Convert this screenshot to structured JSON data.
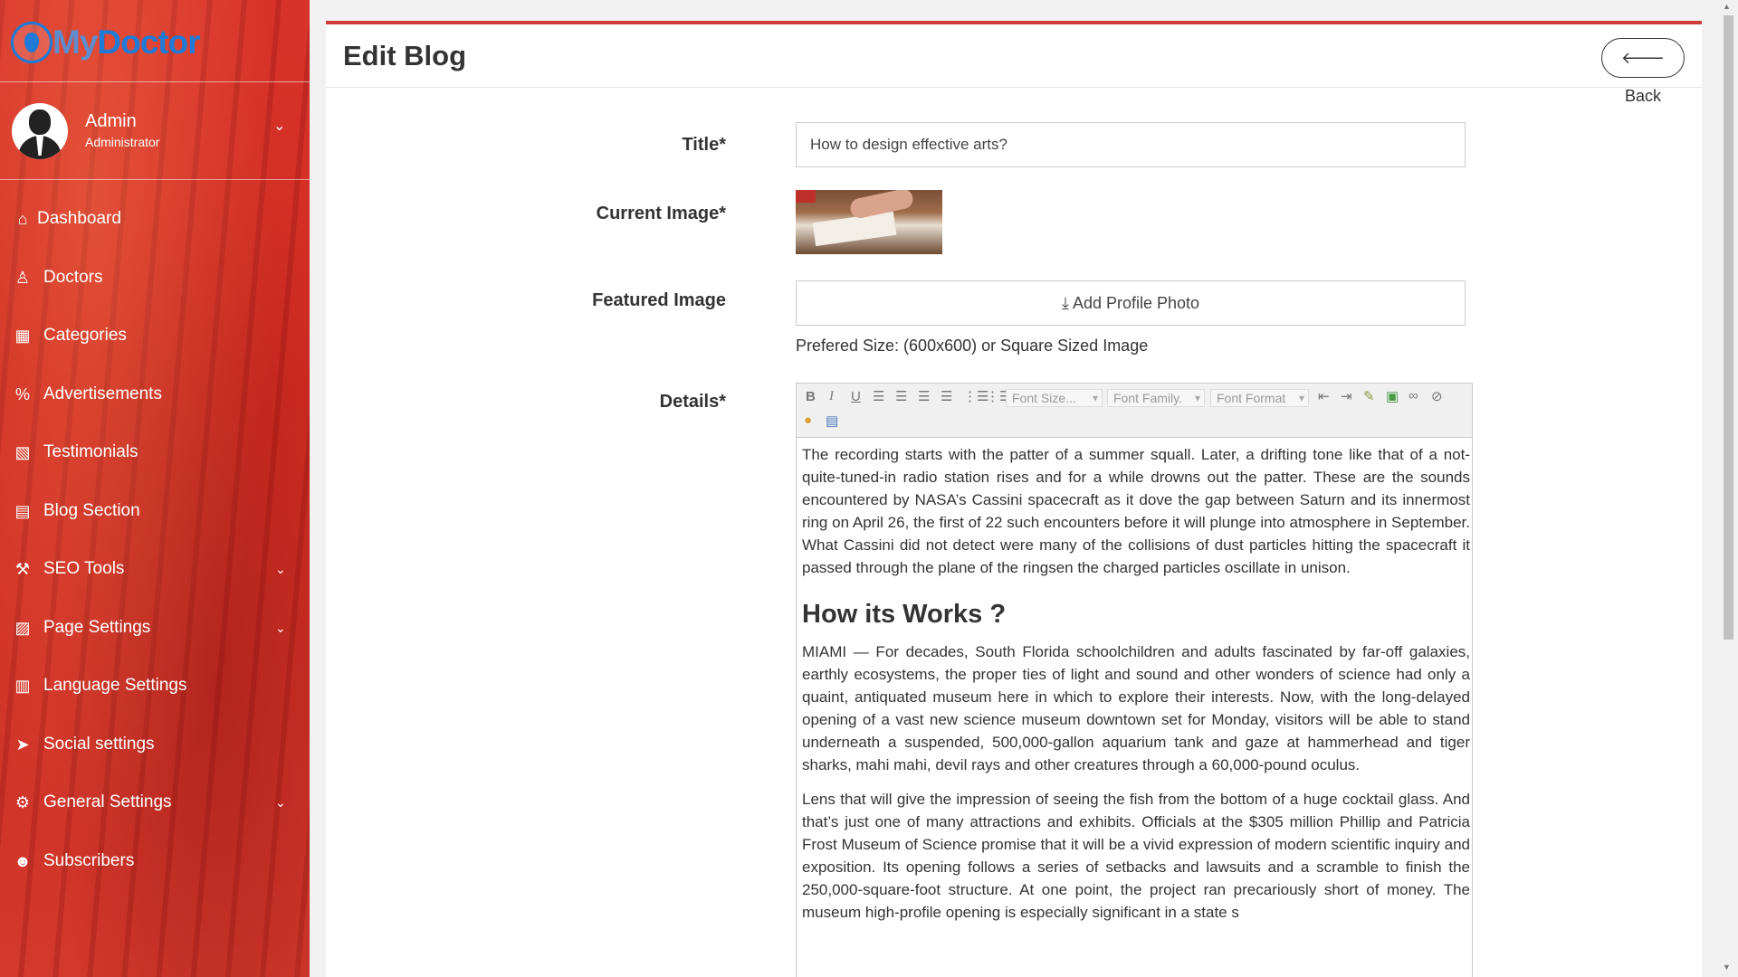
{
  "app": {
    "logo_part1": "My",
    "logo_part2": "Doctor"
  },
  "profile": {
    "name": "Admin",
    "role": "Administrator"
  },
  "sidebar": {
    "items": [
      {
        "label": "Dashboard",
        "icon": "home-icon",
        "glyph": "⌂",
        "has_submenu": false
      },
      {
        "label": "Doctors",
        "icon": "user-doctor-icon",
        "glyph": "♙",
        "has_submenu": false
      },
      {
        "label": "Categories",
        "icon": "calendar-icon",
        "glyph": "▦",
        "has_submenu": false
      },
      {
        "label": "Advertisements",
        "icon": "percent-icon",
        "glyph": "%",
        "has_submenu": false
      },
      {
        "label": "Testimonials",
        "icon": "image-file-icon",
        "glyph": "▧",
        "has_submenu": false
      },
      {
        "label": "Blog Section",
        "icon": "file-text-icon",
        "glyph": "▤",
        "has_submenu": false
      },
      {
        "label": "SEO Tools",
        "icon": "wrench-icon",
        "glyph": "⚒",
        "has_submenu": true
      },
      {
        "label": "Page Settings",
        "icon": "code-file-icon",
        "glyph": "▨",
        "has_submenu": true
      },
      {
        "label": "Language Settings",
        "icon": "language-icon",
        "glyph": "▥",
        "has_submenu": false
      },
      {
        "label": "Social settings",
        "icon": "paper-plane-icon",
        "glyph": "➤",
        "has_submenu": false
      },
      {
        "label": "General Settings",
        "icon": "cogs-icon",
        "glyph": "⚙",
        "has_submenu": true
      },
      {
        "label": "Subscribers",
        "icon": "users-icon",
        "glyph": "☻",
        "has_submenu": false
      }
    ]
  },
  "header": {
    "title": "Edit Blog",
    "back_label": "Back"
  },
  "form": {
    "title_label": "Title*",
    "title_value": "How to design effective arts?",
    "current_image_label": "Current Image*",
    "featured_image_label": "Featured Image",
    "add_photo_label": "Add Profile Photo",
    "size_hint": "Prefered Size: (600x600) or Square Sized Image",
    "details_label": "Details*"
  },
  "editor": {
    "font_size_placeholder": "Font Size...",
    "font_family_placeholder": "Font Family.",
    "font_format_placeholder": "Font Format",
    "paragraph1": "The recording starts with the patter of a summer squall. Later, a drifting tone like that of a not-quite-tuned-in radio station rises and for a while drowns out the patter. These are the sounds encountered by NASA’s Cassini spacecraft as it dove the gap between Saturn and its innermost ring on April 26, the first of 22 such encounters before it will plunge into atmosphere in September. What Cassini did not detect were many of the collisions of dust particles hitting the spacecraft it passed through the plane of the ringsen the charged particles oscillate in unison.",
    "heading": "How its Works ?",
    "paragraph2": "MIAMI — For decades, South Florida schoolchildren and adults fascinated by far-off galaxies, earthly ecosystems, the proper ties of light and sound and other wonders of science had only a quaint, antiquated museum here in which to explore their interests. Now, with the long-delayed opening of a vast new science museum downtown set for Monday, visitors will be able to stand underneath a suspended, 500,000-gallon aquarium tank and gaze at hammerhead and tiger sharks, mahi mahi, devil rays and other creatures through a 60,000-pound oculus.",
    "paragraph3": "Lens that will give the impression of seeing the fish from the bottom of a huge cocktail glass. And that’s just one of many attractions and exhibits. Officials at the $305 million Phillip and Patricia Frost Museum of Science promise that it will be a vivid expression of modern scientific inquiry and exposition. Its opening follows a series of setbacks and lawsuits and a scramble to finish the 250,000-square-foot structure. At one point, the project ran precariously short of money. The museum high-profile opening is especially significant in a state s"
  },
  "colors": {
    "sidebar": "#d2352a",
    "panel_accent": "#cf3b38",
    "logo_blue": "#1f7ad8"
  }
}
